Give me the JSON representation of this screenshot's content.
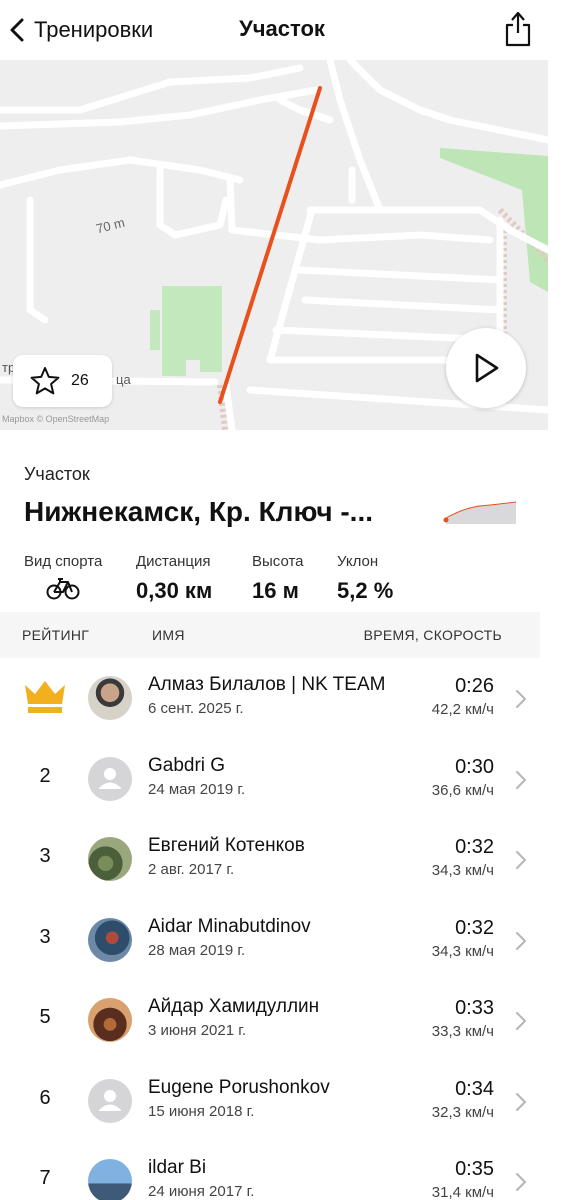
{
  "header": {
    "back_label": "Тренировки",
    "title": "Участок"
  },
  "map": {
    "contour_label": "70 m",
    "street_fragment_left": "тр",
    "street_fragment_right": "ца",
    "attribution": "Mapbox © OpenStreetMap",
    "favorite_count": "26"
  },
  "segment": {
    "label": "Участок",
    "name": "Нижнекамск, Кр. Ключ -..."
  },
  "stats": {
    "sport_label": "Вид спорта",
    "distance_label": "Дистанция",
    "distance_value": "0,30 км",
    "elevation_label": "Высота",
    "elevation_value": "16 м",
    "grade_label": "Уклон",
    "grade_value": "5,2 %"
  },
  "table": {
    "col_rank": "РЕЙТИНГ",
    "col_name": "ИМЯ",
    "col_time": "ВРЕМЯ, СКОРОСТЬ",
    "rows": [
      {
        "rank": "",
        "name": "Алмаз Билалов | NK TEAM",
        "date": "6 сент. 2025 г.",
        "time": "0:26",
        "speed": "42,2 км/ч",
        "avatar": "photo"
      },
      {
        "rank": "2",
        "name": "Gabdri G",
        "date": "24 мая 2019 г.",
        "time": "0:30",
        "speed": "36,6 км/ч",
        "avatar": "placeholder"
      },
      {
        "rank": "3",
        "name": "Евгений Котенков",
        "date": "2 авг. 2017 г.",
        "time": "0:32",
        "speed": "34,3 км/ч",
        "avatar": "photo"
      },
      {
        "rank": "3",
        "name": "Aidar Minabutdinov",
        "date": "28 мая 2019 г.",
        "time": "0:32",
        "speed": "34,3 км/ч",
        "avatar": "photo"
      },
      {
        "rank": "5",
        "name": "Айдар Хамидуллин",
        "date": "3 июня 2021 г.",
        "time": "0:33",
        "speed": "33,3 км/ч",
        "avatar": "photo"
      },
      {
        "rank": "6",
        "name": "Eugene Porushonkov",
        "date": "15 июня 2018 г.",
        "time": "0:34",
        "speed": "32,3 км/ч",
        "avatar": "placeholder"
      },
      {
        "rank": "7",
        "name": "ildar Bi",
        "date": "24 июня 2017 г.",
        "time": "0:35",
        "speed": "31,4 км/ч",
        "avatar": "photo"
      }
    ]
  },
  "colors": {
    "route": "#e8501c",
    "crown": "#f2b01e",
    "park": "#bde5b5"
  },
  "icons": {
    "back": "chevron-left-icon",
    "share": "share-icon",
    "favorite": "star-icon",
    "play": "play-icon",
    "sport": "bicycle-icon",
    "first_place": "crown-icon",
    "row_arrow": "chevron-right-icon"
  }
}
